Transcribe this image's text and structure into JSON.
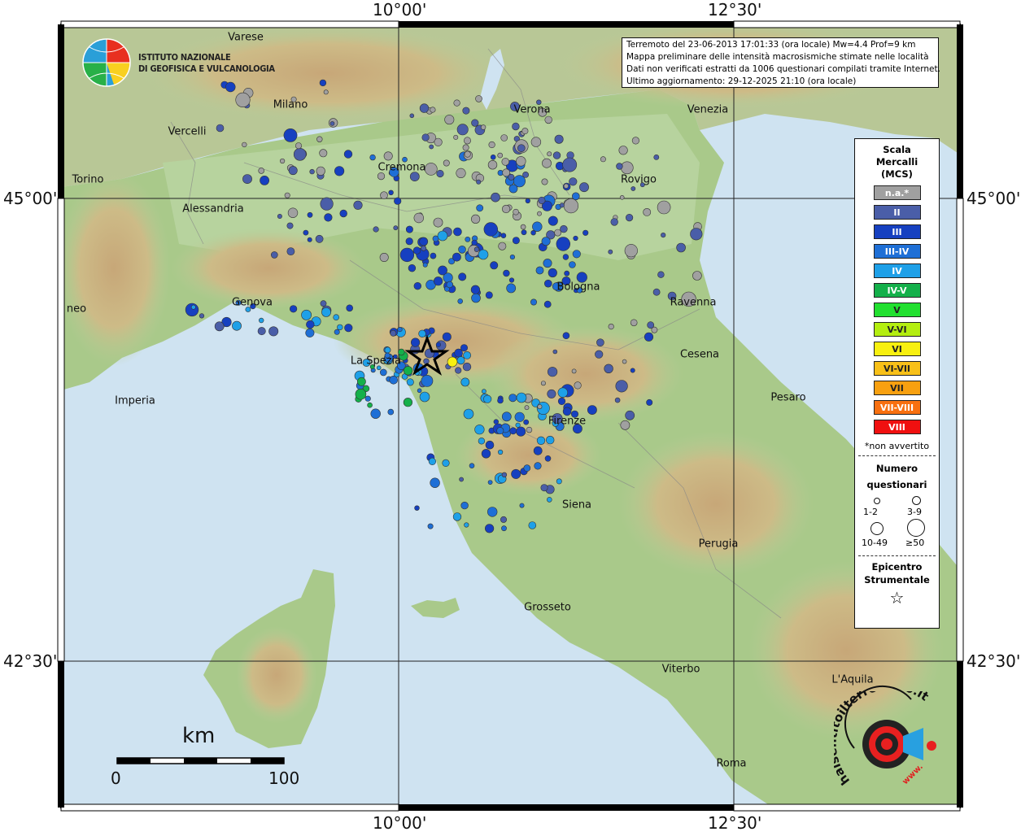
{
  "coords": {
    "lon_left": "10°00'",
    "lon_right": "12°30'",
    "lat_top": "45°00'",
    "lat_bottom": "42°30'"
  },
  "info_box": {
    "line1": "Terremoto del 23-06-2013 17:01:33 (ora locale) Mw=4.4 Prof=9 km",
    "line2": "Mappa preliminare delle intensità macrosismiche stimate nelle località",
    "line3": "Dati non verificati estratti da 1006 questionari compilati tramite Internet.",
    "line4": "Ultimo aggiornamento: 29-12-2025 21:10 (ora locale)"
  },
  "logo": {
    "line1": "ISTITUTO NAZIONALE",
    "line2": "DI GEOFISICA E VULCANOLOGIA",
    "badge_text": "haisentitoilterremoto.it",
    "badge_url": "www."
  },
  "cities": [
    {
      "name": "Varese"
    },
    {
      "name": "Milano"
    },
    {
      "name": "Vercelli"
    },
    {
      "name": "Verona"
    },
    {
      "name": "Venezia"
    },
    {
      "name": "Cremona"
    },
    {
      "name": "Torino"
    },
    {
      "name": "Rovigo"
    },
    {
      "name": "Alessandria"
    },
    {
      "name": "Bologna"
    },
    {
      "name": "Genova"
    },
    {
      "name": "Ravenna"
    },
    {
      "name": "neo"
    },
    {
      "name": "La Spezia"
    },
    {
      "name": "Cesena"
    },
    {
      "name": "Pesaro"
    },
    {
      "name": "Imperia"
    },
    {
      "name": "Firenze"
    },
    {
      "name": "Siena"
    },
    {
      "name": "Perugia"
    },
    {
      "name": "Grosseto"
    },
    {
      "name": "Viterbo"
    },
    {
      "name": "L'Aquila"
    },
    {
      "name": "Roma"
    }
  ],
  "legend": {
    "title1": "Scala",
    "title2": "Mercalli",
    "title3": "(MCS)",
    "classes": [
      {
        "label": "n.a.*",
        "color": "#a0a0a0"
      },
      {
        "label": "II",
        "color": "#4a5ea8"
      },
      {
        "label": "III",
        "color": "#1640c0"
      },
      {
        "label": "III-IV",
        "color": "#1e6fd6"
      },
      {
        "label": "IV",
        "color": "#1ea0e8"
      },
      {
        "label": "IV-V",
        "color": "#14b04a"
      },
      {
        "label": "V",
        "color": "#22e030"
      },
      {
        "label": "V-VI",
        "color": "#b4ee10"
      },
      {
        "label": "VI",
        "color": "#f8f010"
      },
      {
        "label": "VI-VII",
        "color": "#f8c018"
      },
      {
        "label": "VII",
        "color": "#f8a010"
      },
      {
        "label": "VII-VIII",
        "color": "#f87010"
      },
      {
        "label": "VIII",
        "color": "#f01010"
      }
    ],
    "na_note": "*non avvertito",
    "numero1": "Numero",
    "numero2": "questionari",
    "size_labels": [
      "1-2",
      "3-9",
      "10-49",
      "≥50"
    ],
    "epi1": "Epicentro",
    "epi2": "Strumentale"
  },
  "scale_bar": {
    "unit": "km",
    "start": "0",
    "end": "100"
  }
}
